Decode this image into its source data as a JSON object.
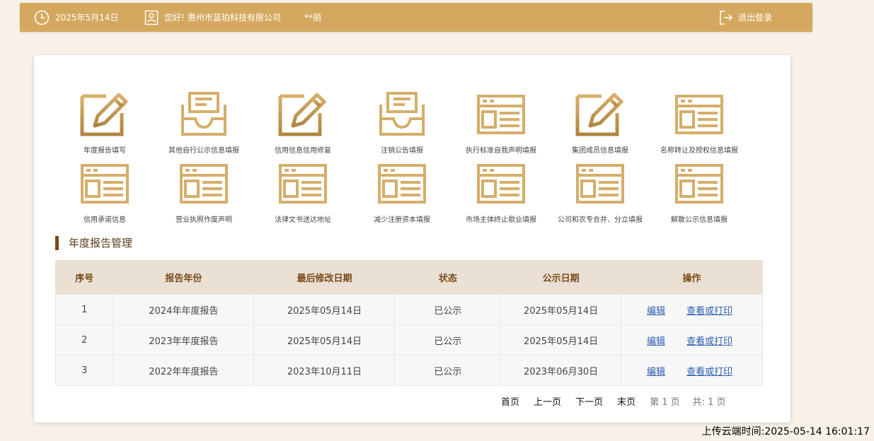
{
  "header": {
    "date": "2025年5月14日",
    "greeting": "您好!",
    "company": "惠州市蓝珀科技有限公司",
    "masked_name": "**丽",
    "logout_label": "退出登录"
  },
  "menu": [
    {
      "label": "年度报告填写",
      "icon": "edit-icon"
    },
    {
      "label": "其他自行公示信息填报",
      "icon": "tray-icon"
    },
    {
      "label": "信用信息信用修复",
      "icon": "edit-icon"
    },
    {
      "label": "注销公告填报",
      "icon": "tray-icon"
    },
    {
      "label": "执行标准自我声明填报",
      "icon": "form-icon"
    },
    {
      "label": "集团成员信息填报",
      "icon": "edit-icon"
    },
    {
      "label": "名称转让及授权信息填报",
      "icon": "form-icon"
    },
    {
      "label": "信用承诺信息",
      "icon": "form-icon"
    },
    {
      "label": "营业执照作废声明",
      "icon": "form-icon"
    },
    {
      "label": "法律文书送达地址",
      "icon": "form-icon"
    },
    {
      "label": "减少注册资本填报",
      "icon": "form-icon"
    },
    {
      "label": "市场主体终止歇业填报",
      "icon": "form-icon"
    },
    {
      "label": "公司和农专合并、分立填报",
      "icon": "form-icon"
    },
    {
      "label": "解散公示信息填报",
      "icon": "form-icon"
    }
  ],
  "section_title": "年度报告管理",
  "table": {
    "headers": [
      "序号",
      "报告年份",
      "最后修改日期",
      "状态",
      "公示日期",
      "操作"
    ],
    "rows": [
      {
        "no": "1",
        "year": "2024年年度报告",
        "modified": "2025年05月14日",
        "status": "已公示",
        "publish": "2025年05月14日",
        "edit": "编辑",
        "view": "查看或打印"
      },
      {
        "no": "2",
        "year": "2023年年度报告",
        "modified": "2025年05月14日",
        "status": "已公示",
        "publish": "2025年05月14日",
        "edit": "编辑",
        "view": "查看或打印"
      },
      {
        "no": "3",
        "year": "2022年年度报告",
        "modified": "2023年10月11日",
        "status": "已公示",
        "publish": "2023年06月30日",
        "edit": "编辑",
        "view": "查看或打印"
      }
    ]
  },
  "pager": {
    "first": "首页",
    "prev": "上一页",
    "next": "下一页",
    "last": "末页",
    "current": "第 1 页",
    "total": "共:  1 页"
  },
  "upload_time": "上传云端时间:2025-05-14 16:01:17",
  "colors": {
    "header_bg": "#d4a85e",
    "icon_gold": "#c9a05c",
    "link_blue": "#2e5fb2",
    "table_header_bg": "#eae0d3"
  }
}
